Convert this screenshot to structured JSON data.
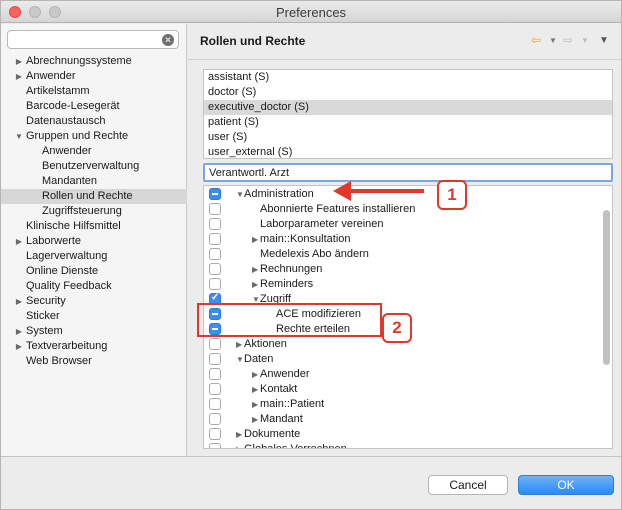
{
  "window": {
    "title": "Preferences"
  },
  "sidebar": {
    "search_value": "",
    "items": [
      {
        "label": "Abrechnungssysteme",
        "indent": 0,
        "expander": "collapsed"
      },
      {
        "label": "Anwender",
        "indent": 0,
        "expander": "collapsed"
      },
      {
        "label": "Artikelstamm",
        "indent": 0,
        "expander": "none"
      },
      {
        "label": "Barcode-Lesegerät",
        "indent": 0,
        "expander": "none"
      },
      {
        "label": "Datenaustausch",
        "indent": 0,
        "expander": "none"
      },
      {
        "label": "Gruppen und Rechte",
        "indent": 0,
        "expander": "expanded"
      },
      {
        "label": "Anwender",
        "indent": 1,
        "expander": "none"
      },
      {
        "label": "Benutzerverwaltung",
        "indent": 1,
        "expander": "none"
      },
      {
        "label": "Mandanten",
        "indent": 1,
        "expander": "none"
      },
      {
        "label": "Rollen und Rechte",
        "indent": 1,
        "expander": "none",
        "selected": true
      },
      {
        "label": "Zugriffsteuerung",
        "indent": 1,
        "expander": "none"
      },
      {
        "label": "Klinische Hilfsmittel",
        "indent": 0,
        "expander": "none"
      },
      {
        "label": "Laborwerte",
        "indent": 0,
        "expander": "collapsed"
      },
      {
        "label": "Lagerverwaltung",
        "indent": 0,
        "expander": "none"
      },
      {
        "label": "Online Dienste",
        "indent": 0,
        "expander": "none"
      },
      {
        "label": "Quality Feedback",
        "indent": 0,
        "expander": "none"
      },
      {
        "label": "Security",
        "indent": 0,
        "expander": "collapsed"
      },
      {
        "label": "Sticker",
        "indent": 0,
        "expander": "none"
      },
      {
        "label": "System",
        "indent": 0,
        "expander": "collapsed"
      },
      {
        "label": "Textverarbeitung",
        "indent": 0,
        "expander": "collapsed"
      },
      {
        "label": "Web Browser",
        "indent": 0,
        "expander": "none"
      }
    ]
  },
  "page": {
    "title": "Rollen und Rechte",
    "roles": [
      {
        "label": "assistant (S)"
      },
      {
        "label": "doctor (S)"
      },
      {
        "label": "executive_doctor (S)",
        "selected": true
      },
      {
        "label": "patient (S)"
      },
      {
        "label": "user (S)"
      },
      {
        "label": "user_external (S)"
      }
    ],
    "role_name_value": "Verantwortl. Arzt",
    "rights": [
      {
        "label": "Administration",
        "level": 0,
        "expander": "expanded",
        "check": "mixed"
      },
      {
        "label": "Abonnierte Features installieren",
        "level": 1,
        "expander": "none",
        "check": "unchecked"
      },
      {
        "label": "Laborparameter vereinen",
        "level": 1,
        "expander": "none",
        "check": "unchecked"
      },
      {
        "label": "main::Konsultation",
        "level": 1,
        "expander": "collapsed",
        "check": "unchecked"
      },
      {
        "label": "Medelexis Abo ändern",
        "level": 1,
        "expander": "none",
        "check": "unchecked"
      },
      {
        "label": "Rechnungen",
        "level": 1,
        "expander": "collapsed",
        "check": "unchecked"
      },
      {
        "label": "Reminders",
        "level": 1,
        "expander": "collapsed",
        "check": "unchecked"
      },
      {
        "label": "Zugriff",
        "level": 1,
        "expander": "expanded",
        "check": "checked"
      },
      {
        "label": "ACE modifizieren",
        "level": 2,
        "expander": "none",
        "check": "mixed"
      },
      {
        "label": "Rechte erteilen",
        "level": 2,
        "expander": "none",
        "check": "mixed"
      },
      {
        "label": "Aktionen",
        "level": 0,
        "expander": "collapsed",
        "check": "unchecked"
      },
      {
        "label": "Daten",
        "level": 0,
        "expander": "expanded",
        "check": "unchecked"
      },
      {
        "label": "Anwender",
        "level": 1,
        "expander": "collapsed",
        "check": "unchecked"
      },
      {
        "label": "Kontakt",
        "level": 1,
        "expander": "collapsed",
        "check": "unchecked"
      },
      {
        "label": "main::Patient",
        "level": 1,
        "expander": "collapsed",
        "check": "unchecked"
      },
      {
        "label": "Mandant",
        "level": 1,
        "expander": "collapsed",
        "check": "unchecked"
      },
      {
        "label": "Dokumente",
        "level": 0,
        "expander": "collapsed",
        "check": "unchecked"
      },
      {
        "label": "Globales Verrechnen",
        "level": 0,
        "expander": "collapsed",
        "check": "unchecked"
      }
    ],
    "annotations": {
      "badge1": "1",
      "badge2": "2"
    },
    "colors": {
      "annotation": "#e0382b",
      "accent": "#3a8ef6"
    }
  },
  "buttons": {
    "cancel": "Cancel",
    "ok": "OK"
  }
}
